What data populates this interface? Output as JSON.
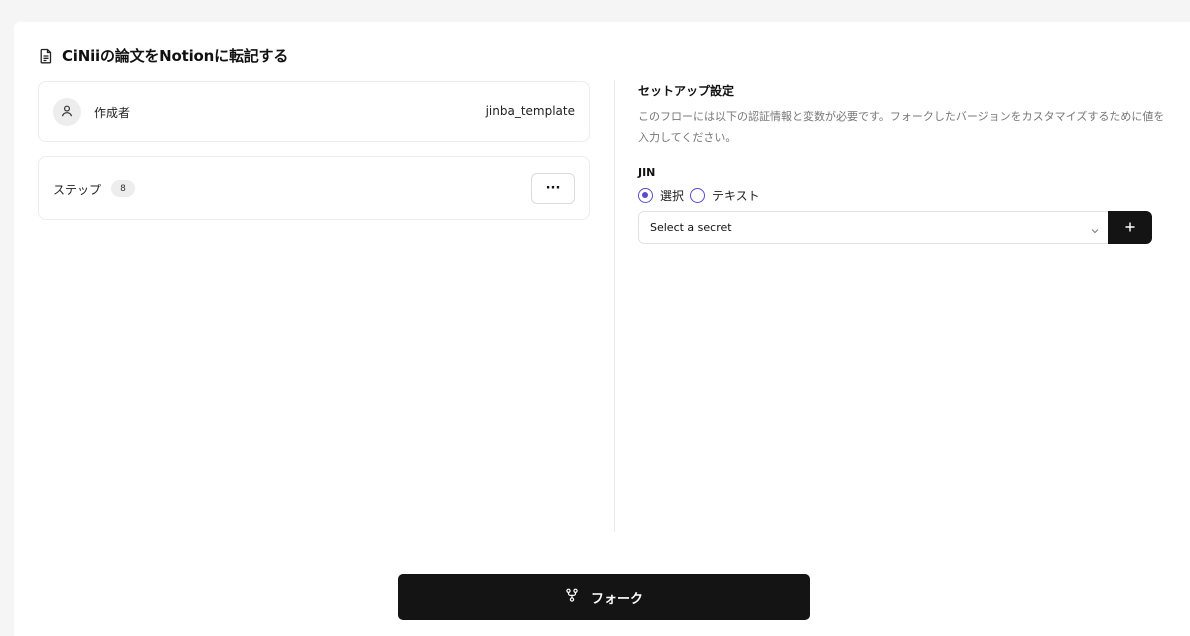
{
  "header": {
    "title": "CiNiiの論文をNotionに転記する",
    "title_icon": "document-icon"
  },
  "author": {
    "label": "作成者",
    "name": "jinba_template",
    "icon": "user-icon"
  },
  "steps": {
    "label": "ステップ",
    "count": "8",
    "more_label": "···"
  },
  "setup": {
    "title": "セットアップ設定",
    "description": "このフローには以下の認証情報と変数が必要です。フォークしたバージョンをカスタマイズするために値を入力してください。",
    "field_label": "JIN",
    "radio_options": [
      {
        "label": "選択",
        "checked": true
      },
      {
        "label": "テキスト",
        "checked": false
      }
    ],
    "select_placeholder": "Select a secret",
    "add_icon": "plus-icon"
  },
  "footer": {
    "fork_label": "フォーク",
    "fork_icon": "fork-icon"
  },
  "colors": {
    "accent": "#5b4ad1",
    "button_dark": "#141414"
  }
}
